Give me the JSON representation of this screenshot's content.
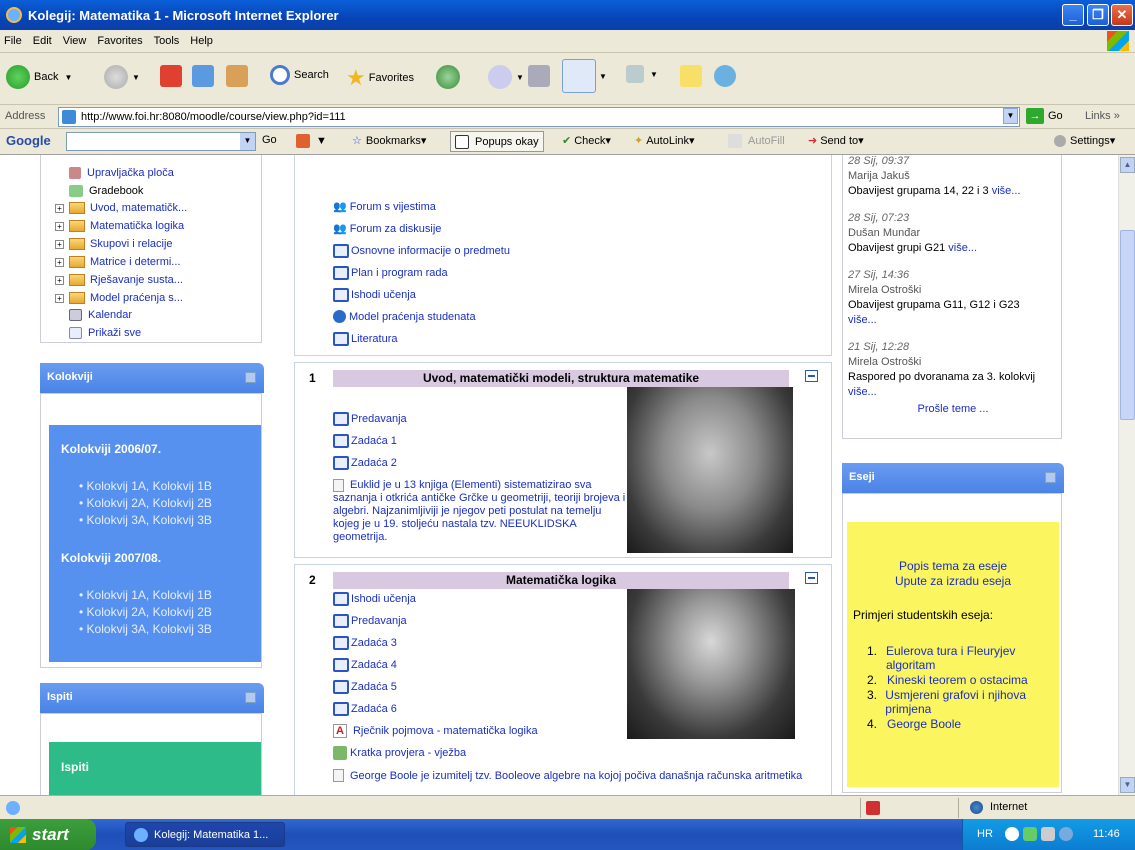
{
  "window": {
    "title": "Kolegij: Matematika 1 - Microsoft Internet Explorer"
  },
  "menu": [
    "File",
    "Edit",
    "View",
    "Favorites",
    "Tools",
    "Help"
  ],
  "toolbar": {
    "back": "Back",
    "search": "Search",
    "favorites": "Favorites"
  },
  "address": {
    "label": "Address",
    "url": "http://www.foi.hr:8080/moodle/course/view.php?id=111",
    "go": "Go",
    "links": "Links"
  },
  "google": {
    "label": "Google",
    "go": "Go",
    "bookmarks": "Bookmarks",
    "popups": "Popups okay",
    "check": "Check",
    "autolink": "AutoLink",
    "autofill": "AutoFill",
    "sendto": "Send to",
    "settings": "Settings"
  },
  "left": {
    "tree": [
      {
        "label": "Upravljačka ploča",
        "type": "icon"
      },
      {
        "label": "Gradebook",
        "type": "icon"
      },
      {
        "label": "Uvod, matematičk...",
        "type": "folder"
      },
      {
        "label": "Matematička logika",
        "type": "folder"
      },
      {
        "label": "Skupovi i relacije",
        "type": "folder"
      },
      {
        "label": "Matrice i determi...",
        "type": "folder"
      },
      {
        "label": "Rješavanje susta...",
        "type": "folder"
      },
      {
        "label": "Model praćenja s...",
        "type": "folder"
      },
      {
        "label": "Kalendar",
        "type": "icon"
      },
      {
        "label": "Prikaži sve",
        "type": "icon"
      }
    ],
    "kolokviji": {
      "title": "Kolokviji",
      "y2006": "Kolokviji 2006/07.",
      "items2006": [
        "Kolokvij 1A, Kolokvij 1B",
        "Kolokvij 2A, Kolokvij 2B",
        "Kolokvij 3A, Kolokvij 3B"
      ],
      "y2007": "Kolokviji 2007/08.",
      "items2007": [
        "Kolokvij 1A, Kolokvij 1B",
        "Kolokvij 2A, Kolokvij 2B",
        "Kolokvij 3A, Kolokvij 3B"
      ]
    },
    "ispiti": {
      "title": "Ispiti",
      "inner": "Ispiti"
    }
  },
  "center": {
    "top": [
      "Forum s vijestima",
      "Forum za diskusije",
      "Osnovne informacije o predmetu",
      "Plan i program rada",
      "Ishodi učenja",
      "Model praćenja studenata",
      "Literatura"
    ],
    "s1": {
      "num": "1",
      "title": "Uvod, matematički modeli, struktura matematike",
      "items": [
        "Predavanja",
        "Zadaća 1",
        "Zadaća 2"
      ],
      "note": "Euklid je u 13 knjiga (Elementi) sistematizirao sva saznanja i otkrića antičke Grčke u geometriji, teoriji brojeva i algebri. Najzanimljiviji je njegov peti postulat na temelju kojeg je u 19. stoljeću nastala tzv. NEEUKLIDSKA geometrija."
    },
    "s2": {
      "num": "2",
      "title": "Matematička logika",
      "items": [
        "Ishodi učenja",
        "Predavanja",
        "Zadaća 3",
        "Zadaća 4",
        "Zadaća 5",
        "Zadaća 6"
      ],
      "glossary": "Rječnik pojmova - matematička logika",
      "quiz": "Kratka provjera - vježba",
      "note": "George Boole je izumitelj tzv. Booleove algebre na kojoj počiva današnja računska aritmetika"
    }
  },
  "right": {
    "news": [
      {
        "date": "28 Sij, 09:37",
        "name": "Marija Jakuš",
        "text": "Obavijest grupama 14, 22 i 3",
        "more": "više..."
      },
      {
        "date": "28 Sij, 07:23",
        "name": "Dušan Munđar",
        "text": "Obavijest grupi G21",
        "more": "više..."
      },
      {
        "date": "27 Sij, 14:36",
        "name": "Mirela Ostroški",
        "text": "Obavijest grupama G11, G12 i G23",
        "more": "više..."
      },
      {
        "date": "21 Sij, 12:28",
        "name": "Mirela Ostroški",
        "text": "Raspored po dvoranama za 3. kolokvij",
        "more": "više..."
      }
    ],
    "older": "Prošle teme ...",
    "eseji": {
      "title": "Eseji",
      "link1": "Popis tema za eseje",
      "link2": "Upute za izradu eseja",
      "examples": "Primjeri studentskih eseja:",
      "list": [
        "Eulerova tura i Fleuryjev algoritam",
        "Kineski teorem o ostacima",
        "Usmjereni grafovi i njihova primjena",
        "George Boole"
      ]
    }
  },
  "status": {
    "zone": "Internet"
  },
  "taskbar": {
    "start": "start",
    "item": "Kolegij: Matematika 1...",
    "lang": "HR",
    "time": "11:46"
  }
}
